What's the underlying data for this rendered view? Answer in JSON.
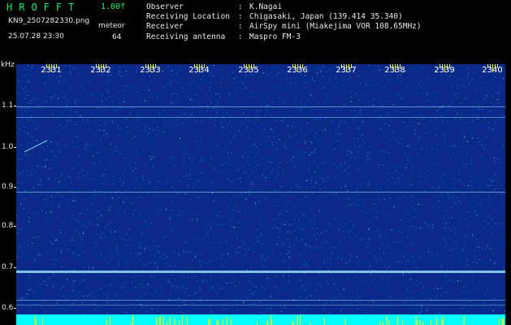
{
  "header": {
    "brand": "HROFFT",
    "version": "1.00f",
    "filename": "KN9_2507282330.png",
    "datetime": "25.07.28 23:30",
    "mode_label": "meteor",
    "mode_value": "64"
  },
  "meta": [
    {
      "label": "Observer",
      "sep": ":",
      "value": "K.Nagai"
    },
    {
      "label": "Receiving Location",
      "sep": ":",
      "value": "Chigasaki, Japan (139.414 35.340)"
    },
    {
      "label": "Receiver",
      "sep": ":",
      "value": "AirSpy mini (Miakejima VOR 108.65MHz)"
    },
    {
      "label": "Receiving antenna",
      "sep": ":",
      "value": "Maspro FM-3"
    }
  ],
  "axis": {
    "unit": "kHz",
    "freq_ticks": [
      "1.1",
      "1.0",
      "0.9",
      "0.8",
      "0.7",
      "0.6"
    ],
    "time_ticks": [
      "2331",
      "2332",
      "2333",
      "2334",
      "2335",
      "2336",
      "2337",
      "2338",
      "2339",
      "2340"
    ]
  },
  "colors": {
    "background": "#000000",
    "spectro_base": "#0a2a8a",
    "noise": "#3c8cff",
    "signal": "#9fe8ff",
    "baseline": "#00ffff",
    "spikes": "#ffff00",
    "brand": "#17f06a"
  }
}
